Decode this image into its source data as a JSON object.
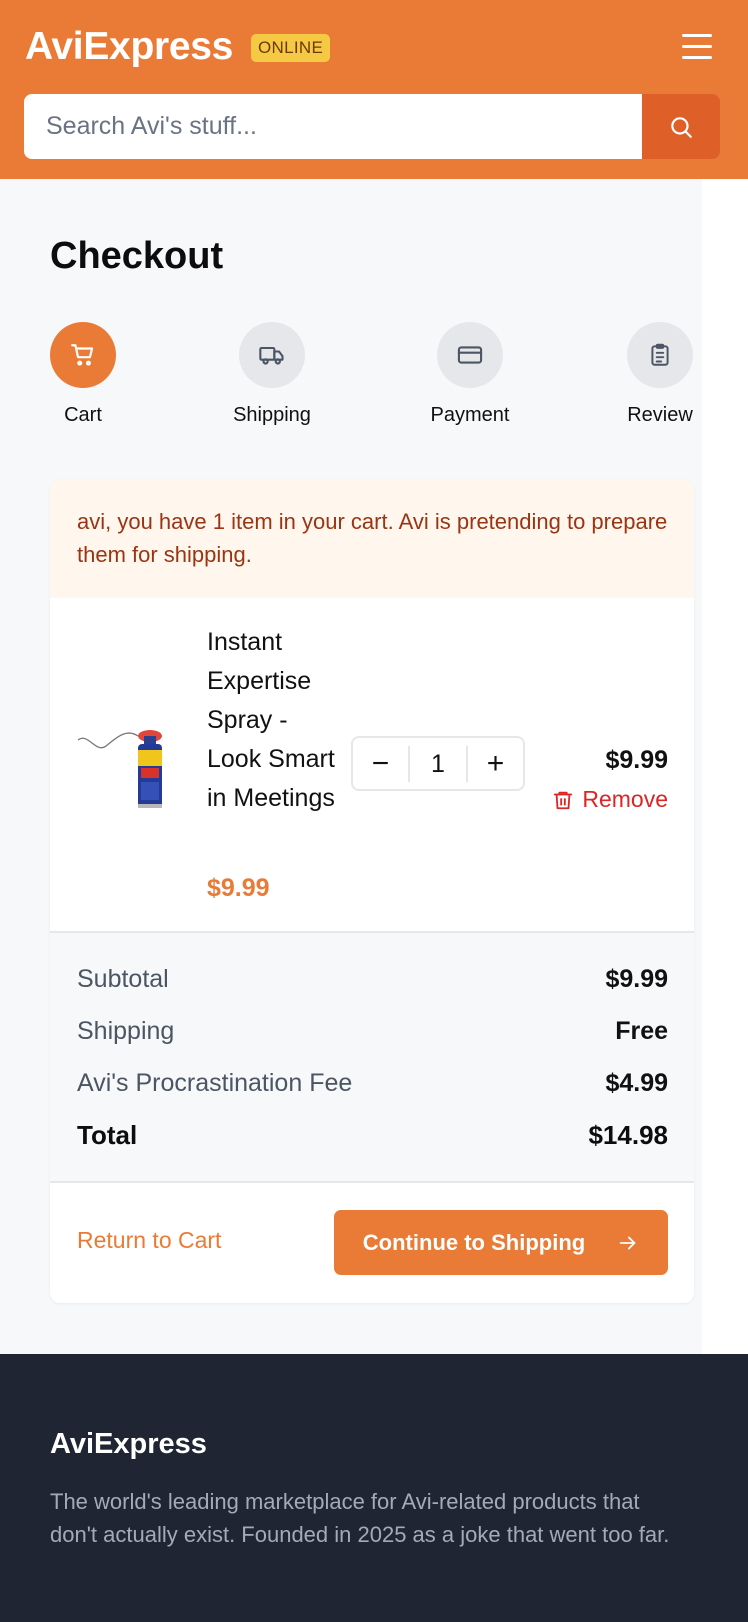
{
  "header": {
    "brand": "AviExpress",
    "badge": "ONLINE",
    "search_placeholder": "Search Avi's stuff...",
    "icons": {
      "menu": "hamburger-menu-icon",
      "search": "search-icon"
    }
  },
  "checkout": {
    "title": "Checkout",
    "steps": [
      {
        "label": "Cart",
        "icon": "cart-icon",
        "active": true
      },
      {
        "label": "Shipping",
        "icon": "truck-icon",
        "active": false
      },
      {
        "label": "Payment",
        "icon": "credit-card-icon",
        "active": false
      },
      {
        "label": "Review",
        "icon": "clipboard-icon",
        "active": false
      }
    ],
    "notice": "avi, you have 1 item in your cart. Avi is pretending to prepare them for shipping.",
    "item": {
      "name": "Instant Expertise Spray - Look Smart in Meetings",
      "price": "$9.99",
      "quantity": "1",
      "line_total": "$9.99",
      "remove_label": "Remove",
      "decrement": "−",
      "increment": "+"
    },
    "summary": {
      "subtotal_label": "Subtotal",
      "subtotal": "$9.99",
      "shipping_label": "Shipping",
      "shipping": "Free",
      "fee_label": "Avi's Procrastination Fee",
      "fee": "$4.99",
      "total_label": "Total",
      "total": "$14.98"
    },
    "actions": {
      "return_label": "Return to Cart",
      "continue_label": "Continue to Shipping"
    }
  },
  "footer": {
    "brand": "AviExpress",
    "text": "The world's leading marketplace for Avi-related products that don't actually exist. Founded in 2025 as a joke that went too far."
  },
  "colors": {
    "accent": "#ea7b36",
    "danger": "#dc2626",
    "footer_bg": "#1f2533",
    "notice_text": "#9a3412"
  }
}
